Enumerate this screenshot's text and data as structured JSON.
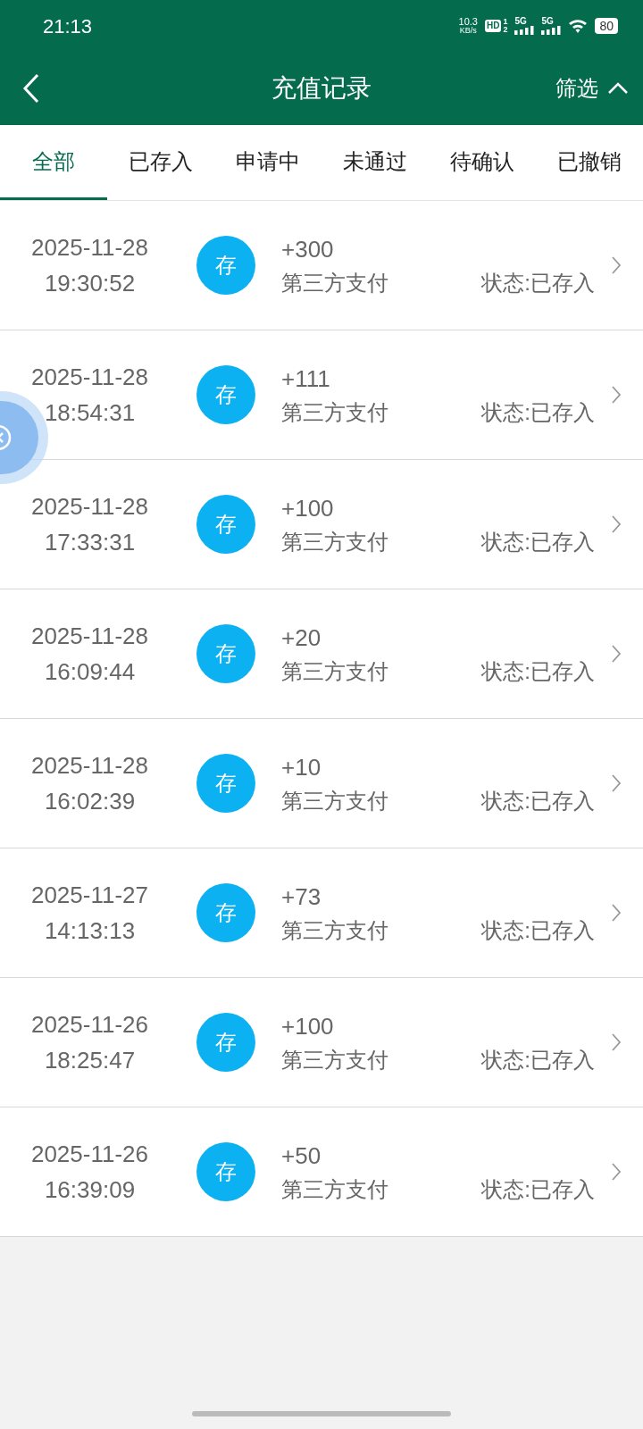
{
  "status_bar": {
    "time": "21:13",
    "speed": "10.3",
    "speed_unit": "KB/s",
    "hd": "HD",
    "sim_1": "1",
    "sim_2": "2",
    "network_1": "5G",
    "network_2": "5G",
    "battery": "80"
  },
  "header": {
    "title": "充值记录",
    "filter": "筛选"
  },
  "tabs": [
    {
      "label": "全部",
      "selected": true
    },
    {
      "label": "已存入",
      "selected": false
    },
    {
      "label": "申请中",
      "selected": false
    },
    {
      "label": "未通过",
      "selected": false
    },
    {
      "label": "待确认",
      "selected": false
    },
    {
      "label": "已撤销",
      "selected": false
    }
  ],
  "records": [
    {
      "date": "2025-11-28",
      "time": "19:30:52",
      "badge": "存",
      "amount": "+300",
      "method": "第三方支付",
      "status": "状态:已存入"
    },
    {
      "date": "2025-11-28",
      "time": "18:54:31",
      "badge": "存",
      "amount": "+111",
      "method": "第三方支付",
      "status": "状态:已存入"
    },
    {
      "date": "2025-11-28",
      "time": "17:33:31",
      "badge": "存",
      "amount": "+100",
      "method": "第三方支付",
      "status": "状态:已存入"
    },
    {
      "date": "2025-11-28",
      "time": "16:09:44",
      "badge": "存",
      "amount": "+20",
      "method": "第三方支付",
      "status": "状态:已存入"
    },
    {
      "date": "2025-11-28",
      "time": "16:02:39",
      "badge": "存",
      "amount": "+10",
      "method": "第三方支付",
      "status": "状态:已存入"
    },
    {
      "date": "2025-11-27",
      "time": "14:13:13",
      "badge": "存",
      "amount": "+73",
      "method": "第三方支付",
      "status": "状态:已存入"
    },
    {
      "date": "2025-11-26",
      "time": "18:25:47",
      "badge": "存",
      "amount": "+100",
      "method": "第三方支付",
      "status": "状态:已存入"
    },
    {
      "date": "2025-11-26",
      "time": "16:39:09",
      "badge": "存",
      "amount": "+50",
      "method": "第三方支付",
      "status": "状态:已存入"
    }
  ]
}
